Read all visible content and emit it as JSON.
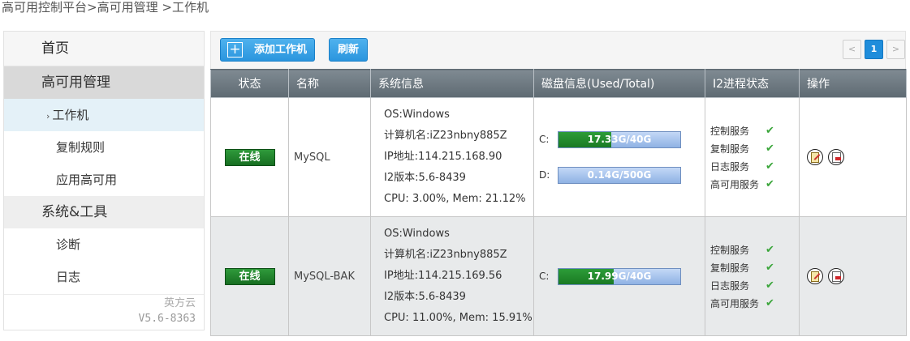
{
  "breadcrumb": {
    "part1": "高可用控制平台",
    "sep1": ">",
    "part2": "高可用管理",
    "sep2": " >",
    "part3": "工作机"
  },
  "sidebar": {
    "home": "首页",
    "group_ha": "高可用管理",
    "items_ha": [
      "工作机",
      "复制规则",
      "应用高可用"
    ],
    "group_tools": "系统&工具",
    "items_tools": [
      "诊断",
      "日志"
    ],
    "brand": "英方云",
    "version": "V5.6-8363"
  },
  "toolbar": {
    "add_label": "添加工作机",
    "add_icon": "plus-icon",
    "refresh_label": "刷新"
  },
  "pagination": {
    "prev": "<",
    "current": "1",
    "next": ">"
  },
  "table": {
    "headers": [
      "状态",
      "名称",
      "系统信息",
      "磁盘信息(Used/Total)",
      "I2进程状态",
      "操作"
    ],
    "rows": [
      {
        "status": "在线",
        "name": "MySQL",
        "sysinfo": [
          "OS:Windows",
          "计算机名:iZ23nbny885Z",
          "IP地址:114.215.168.90",
          "I2版本:5.6-8439",
          "CPU: 3.00%, Mem: 21.12%"
        ],
        "disks": [
          {
            "label": "C:",
            "text": "17.33G/40G",
            "used_fraction": 0.433
          },
          {
            "label": "D:",
            "text": "0.14G/500G",
            "used_fraction": 0.0003
          }
        ],
        "processes": [
          "控制服务",
          "复制服务",
          "日志服务",
          "高可用服务"
        ]
      },
      {
        "status": "在线",
        "name": "MySQL-BAK",
        "sysinfo": [
          "OS:Windows",
          "计算机名:iZ23nbny885Z",
          "IP地址:114.215.169.56",
          "I2版本:5.6-8439",
          "CPU: 11.00%, Mem: 15.91%"
        ],
        "disks": [
          {
            "label": "C:",
            "text": "17.99G/40G",
            "used_fraction": 0.45
          }
        ],
        "processes": [
          "控制服务",
          "复制服务",
          "日志服务",
          "高可用服务"
        ]
      }
    ]
  },
  "colors": {
    "accent": "#2a95de",
    "online": "#1a7a23",
    "header": "#5e6a72",
    "check": "#3ba63b"
  }
}
